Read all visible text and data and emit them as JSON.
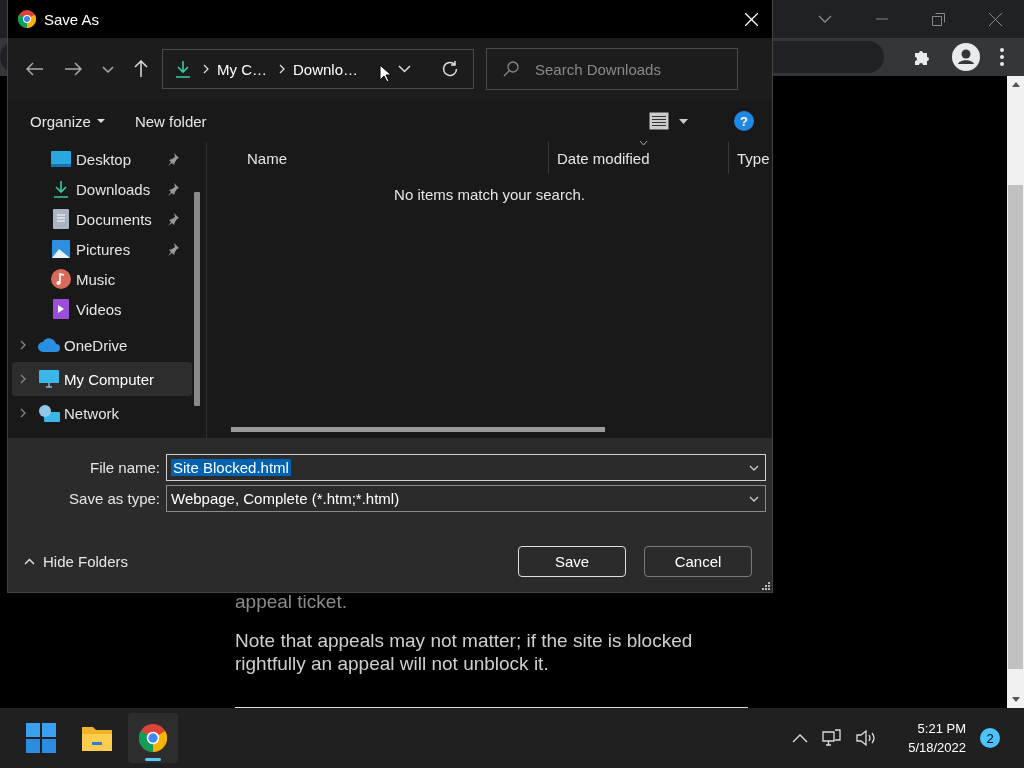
{
  "browser": {
    "page_paragraphs": [
      "appeal ticket.",
      "Note that appeals may not matter; if the site is blocked rightfully an appeal will not unblock it."
    ]
  },
  "window": {
    "title": "Save As"
  },
  "address_bar": {
    "crumbs": [
      "My C…",
      "Downlo…"
    ]
  },
  "search": {
    "placeholder": "Search Downloads"
  },
  "help": "?",
  "toolbar": {
    "organize": "Organize",
    "new_folder": "New folder"
  },
  "sidebar": {
    "quick_access": [
      {
        "kind": "desktop",
        "label": "Desktop",
        "pinned": true,
        "selected": false
      },
      {
        "kind": "downloads",
        "label": "Downloads",
        "pinned": true,
        "selected": false
      },
      {
        "kind": "documents",
        "label": "Documents",
        "pinned": true,
        "selected": false
      },
      {
        "kind": "pictures",
        "label": "Pictures",
        "pinned": true,
        "selected": false
      },
      {
        "kind": "music",
        "label": "Music",
        "pinned": false,
        "selected": false
      },
      {
        "kind": "videos",
        "label": "Videos",
        "pinned": false,
        "selected": false
      }
    ],
    "locations": [
      {
        "kind": "cloud",
        "label": "OneDrive",
        "selected": false
      },
      {
        "kind": "computer",
        "label": "My Computer",
        "selected": true
      },
      {
        "kind": "network",
        "label": "Network",
        "selected": false
      }
    ]
  },
  "file_list": {
    "columns": [
      {
        "label": "Name",
        "sorted": false
      },
      {
        "label": "Date modified",
        "sorted": true
      },
      {
        "label": "Type",
        "sorted": false
      }
    ],
    "empty_message": "No items match your search."
  },
  "file_name": {
    "label": "File name:",
    "value": "Site Blocked.html"
  },
  "save_type": {
    "label": "Save as type:",
    "value": "Webpage, Complete (*.htm;*.html)"
  },
  "hide_folders": "Hide Folders",
  "buttons": [
    {
      "label": "Save",
      "default": true
    },
    {
      "label": "Cancel",
      "default": false
    }
  ],
  "taskbar": {
    "apps": [
      {
        "kind": "start",
        "active": false
      },
      {
        "kind": "folder",
        "active": false
      },
      {
        "kind": "chrome",
        "active": true
      }
    ],
    "time": "5:21 PM",
    "date": "5/18/2022",
    "notifications": "2"
  }
}
